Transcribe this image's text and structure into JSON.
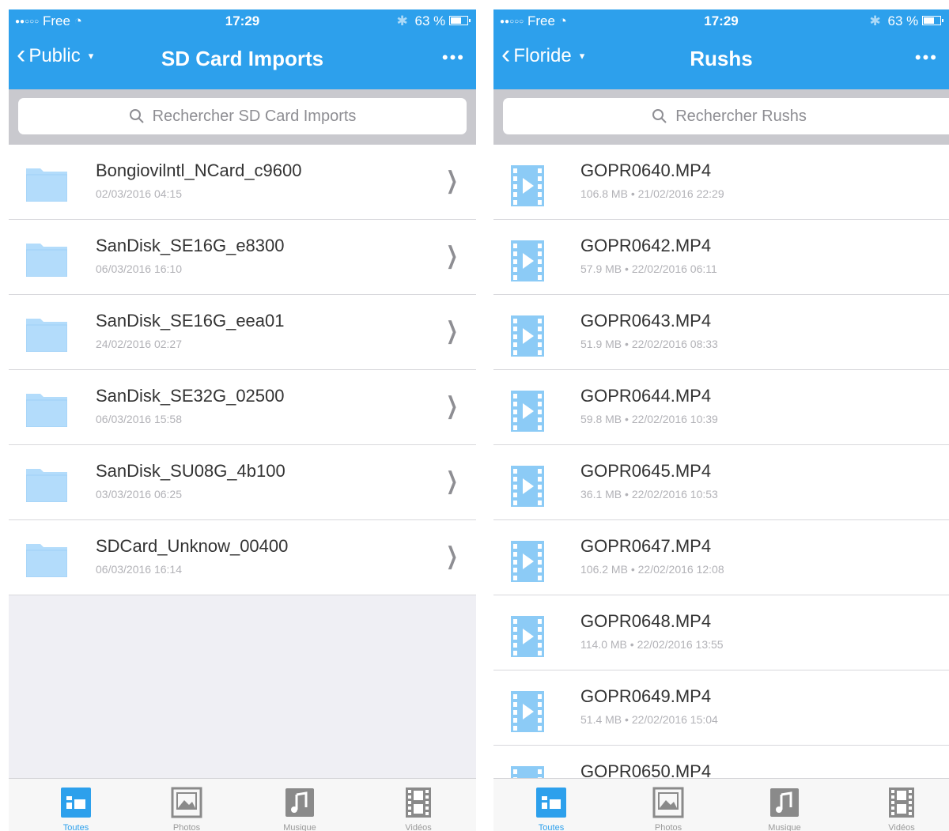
{
  "status": {
    "carrier": "Free",
    "time": "17:29",
    "battery": "63 %"
  },
  "screens": [
    {
      "back_label": "Public",
      "title": "SD Card Imports",
      "search_placeholder": "Rechercher SD Card Imports",
      "items": [
        {
          "name": "Bongiovilntl_NCard_c9600",
          "date": "02/03/2016 04:15"
        },
        {
          "name": "SanDisk_SE16G_e8300",
          "date": "06/03/2016 16:10"
        },
        {
          "name": "SanDisk_SE16G_eea01",
          "date": "24/02/2016 02:27"
        },
        {
          "name": "SanDisk_SE32G_02500",
          "date": "06/03/2016 15:58"
        },
        {
          "name": "SanDisk_SU08G_4b100",
          "date": "03/03/2016 06:25"
        },
        {
          "name": "SDCard_Unknow_00400",
          "date": "06/03/2016 16:14"
        }
      ]
    },
    {
      "back_label": "Floride",
      "title": "Rushs",
      "search_placeholder": "Rechercher Rushs",
      "items": [
        {
          "name": "GOPR0640.MP4",
          "size": "106.8 MB",
          "date": "21/02/2016 22:29"
        },
        {
          "name": "GOPR0642.MP4",
          "size": "57.9 MB",
          "date": "22/02/2016 06:11"
        },
        {
          "name": "GOPR0643.MP4",
          "size": "51.9 MB",
          "date": "22/02/2016 08:33"
        },
        {
          "name": "GOPR0644.MP4",
          "size": "59.8 MB",
          "date": "22/02/2016 10:39"
        },
        {
          "name": "GOPR0645.MP4",
          "size": "36.1 MB",
          "date": "22/02/2016 10:53"
        },
        {
          "name": "GOPR0647.MP4",
          "size": "106.2 MB",
          "date": "22/02/2016 12:08"
        },
        {
          "name": "GOPR0648.MP4",
          "size": "114.0 MB",
          "date": "22/02/2016 13:55"
        },
        {
          "name": "GOPR0649.MP4",
          "size": "51.4 MB",
          "date": "22/02/2016 15:04"
        },
        {
          "name": "GOPR0650.MP4",
          "size": "",
          "date": ""
        }
      ]
    }
  ],
  "tabs": [
    {
      "label": "Toutes",
      "icon": "all-files-icon",
      "active": true
    },
    {
      "label": "Photos",
      "icon": "photo-icon",
      "active": false
    },
    {
      "label": "Musique",
      "icon": "music-icon",
      "active": false
    },
    {
      "label": "Vidéos",
      "icon": "video-icon",
      "active": false
    }
  ],
  "colors": {
    "accent": "#2da0ec",
    "folder": "#b3dcfb",
    "video": "#8ccbf6",
    "tab_inactive": "#8a8a8a"
  }
}
